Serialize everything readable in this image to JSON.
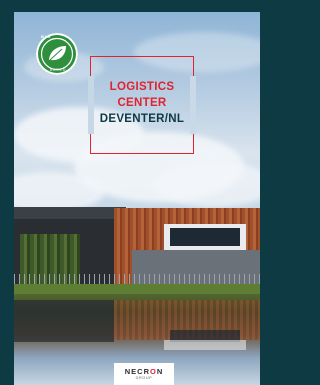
{
  "brochure": {
    "title_line1": "LOGISTICS",
    "title_line2": "CENTER",
    "title_line3": "DEVENTER/NL",
    "badge": {
      "top_text": "B I O",
      "bottom_text": "B A S E D",
      "icon": "leaf-icon"
    },
    "logo": {
      "name_part1": "NEC",
      "name_part2": "R",
      "name_o": "O",
      "name_part3": "N",
      "subtitle": "GROUP"
    },
    "colors": {
      "frame": "#0e3a44",
      "accent_red": "#e0232e",
      "badge_green": "#2f8f3d"
    }
  }
}
